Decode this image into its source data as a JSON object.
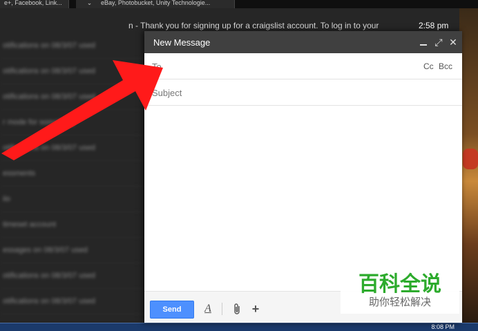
{
  "browser_tabs": [
    {
      "label": "e+, Facebook, Link..."
    },
    {
      "label": "⌄"
    },
    {
      "label": "eBay, Photobucket, Unity Technologie..."
    }
  ],
  "inbox": {
    "top_row_snippet": "n - Thank you for signing up for a craigslist account. To log in to your",
    "top_row_time": "2:58 pm",
    "blurred_rows": [
      {
        "text": "otifications on 08/3/07 used"
      },
      {
        "text": "otifications on 08/3/07 used"
      },
      {
        "text": "otifications on 08/3/07 used"
      },
      {
        "text": "r mode for something"
      },
      {
        "text": "otifications on 08/3/07 used"
      },
      {
        "text": "essments"
      },
      {
        "text": "iio"
      },
      {
        "text": "timeset account"
      },
      {
        "text": "essages on 08/3/07 used"
      },
      {
        "text": "otifications on 08/3/07 used"
      },
      {
        "text": "otifications on 08/3/07 used"
      }
    ]
  },
  "compose": {
    "title": "New Message",
    "to_label": "To",
    "to_value": "",
    "cc_label": "Cc",
    "bcc_label": "Bcc",
    "subject_placeholder": "Subject",
    "subject_value": "",
    "body_value": "",
    "send_label": "Send"
  },
  "taskbar": {
    "clock": "8:08 PM"
  },
  "watermark": {
    "main": "百科全说",
    "sub": "助你轻松解决"
  },
  "colors": {
    "header_bg": "#404040",
    "send_button": "#4d90fe",
    "arrow": "#ff1a1a",
    "watermark_green": "#2dab2d"
  }
}
